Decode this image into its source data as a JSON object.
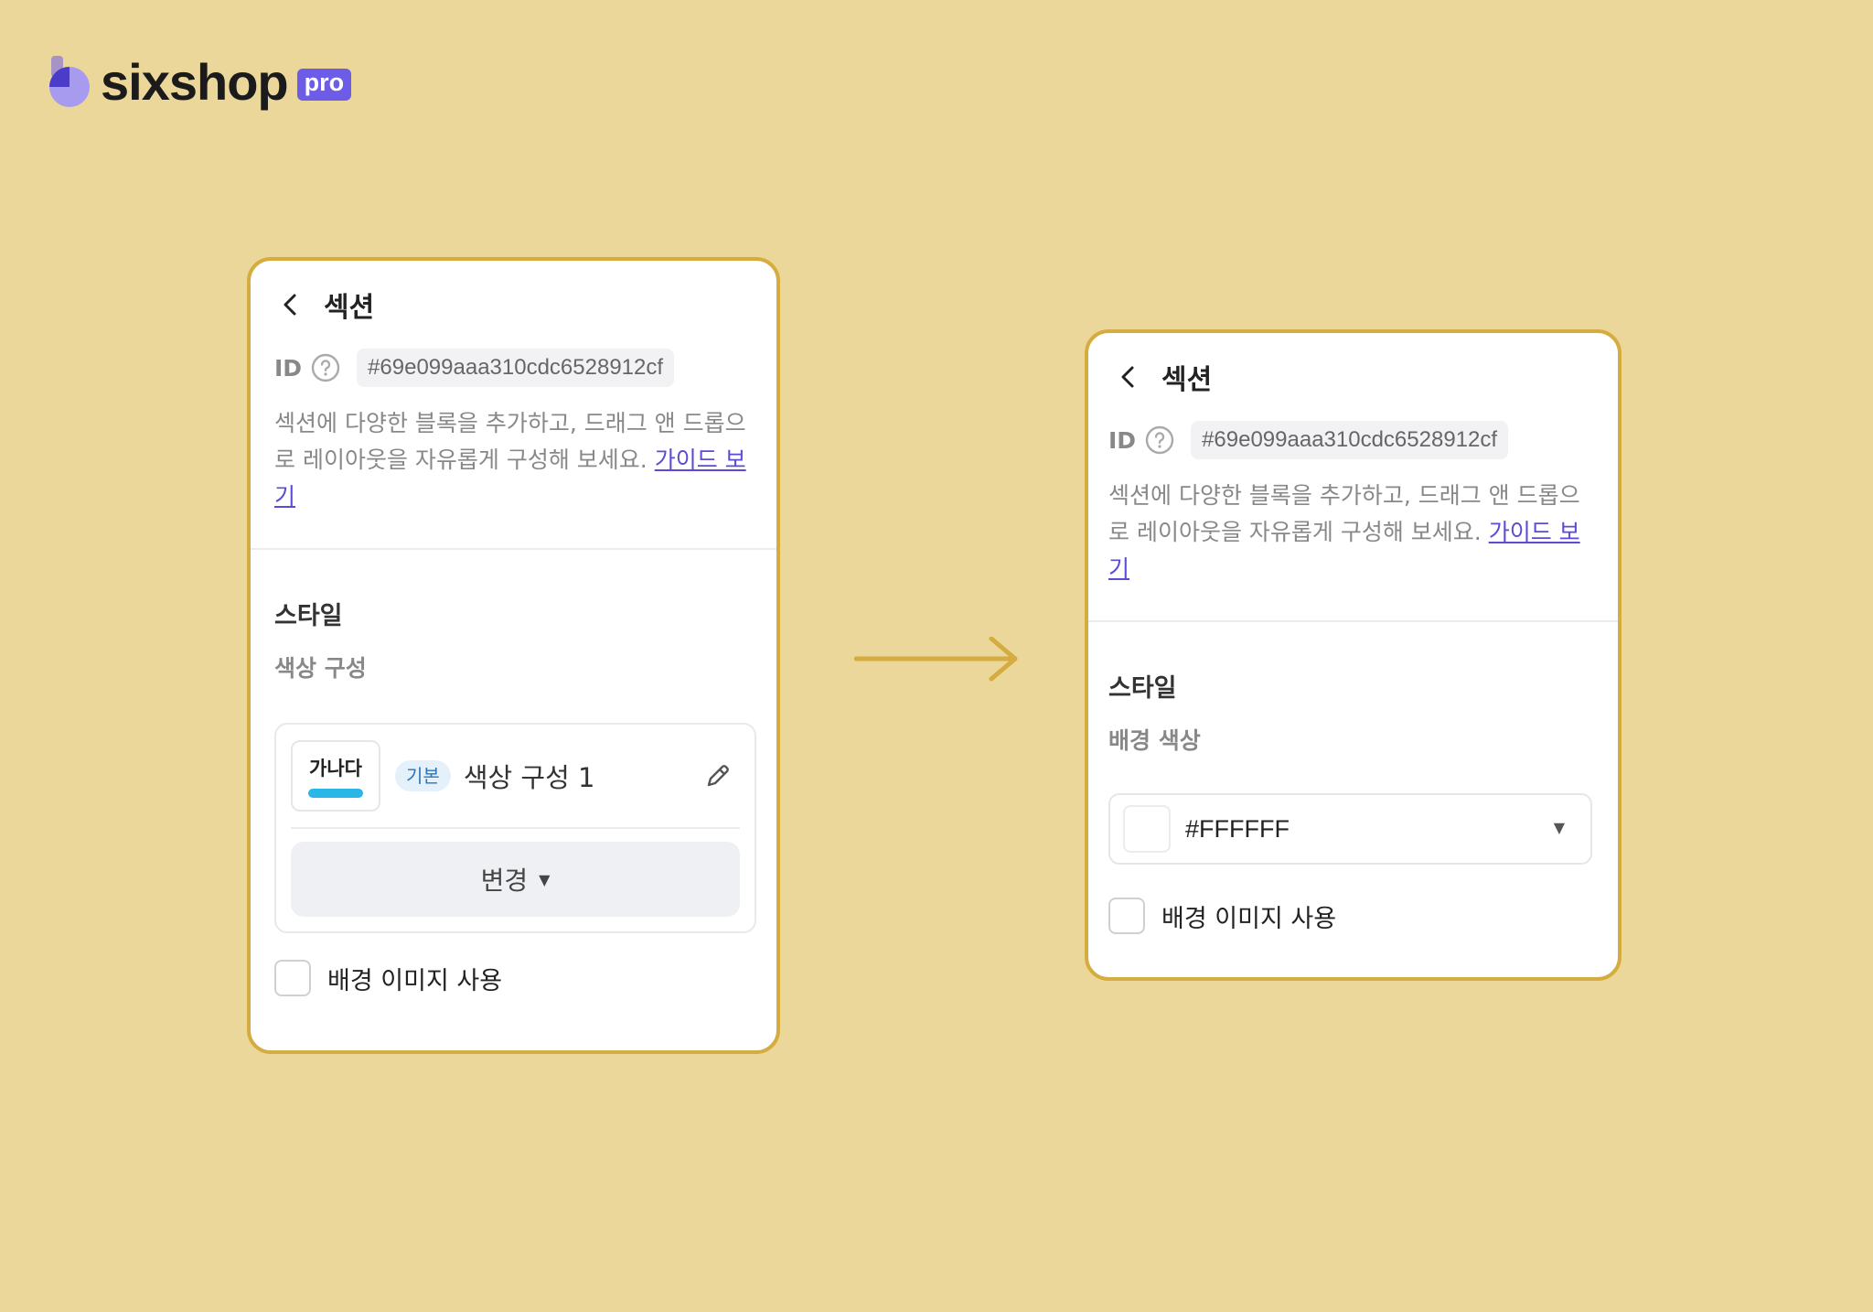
{
  "brand": {
    "name": "sixshop",
    "tag": "pro",
    "accent": "#6c5ce7"
  },
  "before": {
    "title": "섹션",
    "id_label": "ID",
    "id_value": "#69e099aaa310cdc6528912cf",
    "description": "섹션에 다양한 블록을 추가하고, 드래그 앤 드롭으로 레이아웃을 자유롭게 구성해 보세요. ",
    "guide_link": "가이드 보기",
    "style_title": "스타일",
    "color_scheme_label": "색상 구성",
    "swatch_text": "가나다",
    "swatch_accent": "#2bb6e8",
    "badge": "기본",
    "scheme_name": "색상 구성 1",
    "change_button": "변경",
    "bg_image_label": "배경 이미지 사용"
  },
  "after": {
    "title": "섹션",
    "id_label": "ID",
    "id_value": "#69e099aaa310cdc6528912cf",
    "description": "섹션에 다양한 블록을 추가하고, 드래그 앤 드롭으로 레이아웃을 자유롭게 구성해 보세요. ",
    "guide_link": "가이드 보기",
    "style_title": "스타일",
    "bg_color_label": "배경 색상",
    "bg_color_value": "#FFFFFF",
    "bg_image_label": "배경 이미지 사용"
  },
  "colors": {
    "background": "#ecd79b",
    "panel_border": "#d4ac3f",
    "arrow": "#d4ac3f",
    "link": "#5b4bd6"
  }
}
